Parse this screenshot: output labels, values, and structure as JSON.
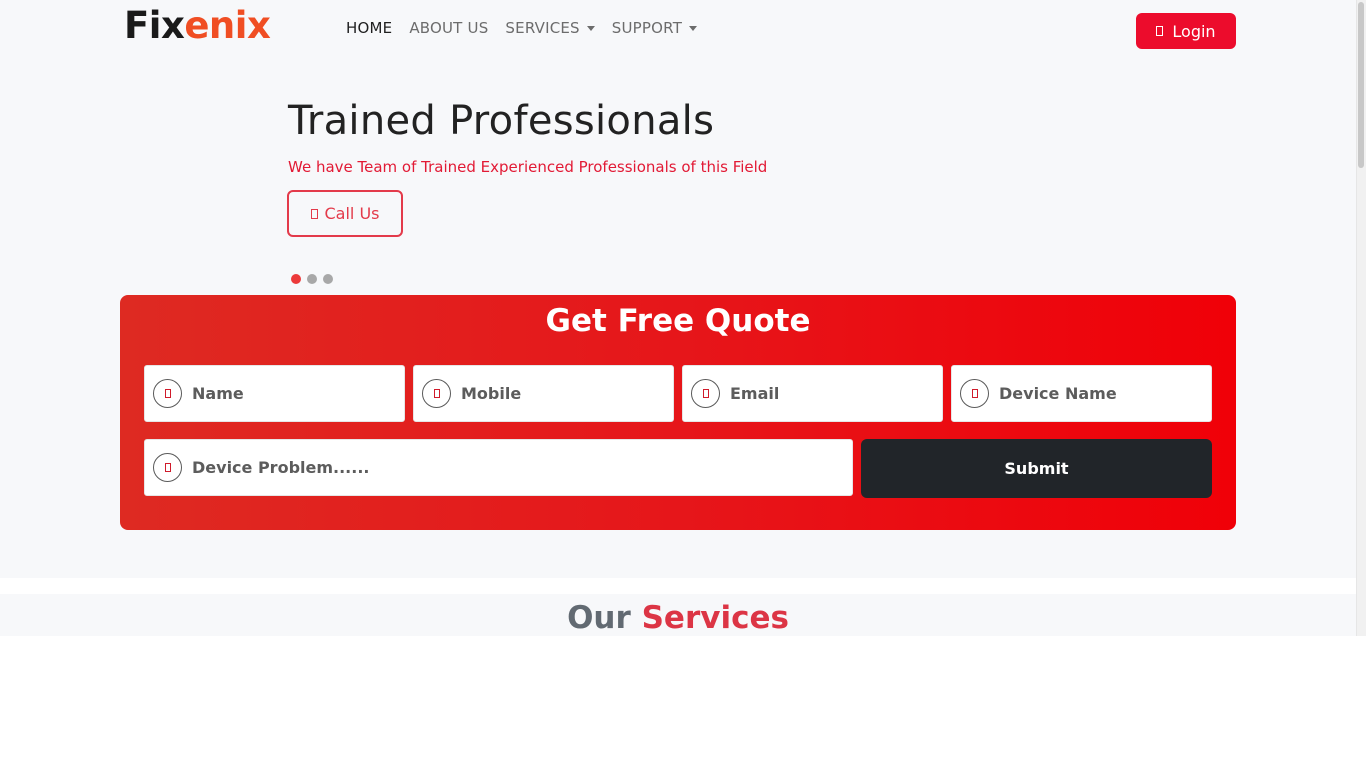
{
  "brand": {
    "part1": "Fix",
    "part2": "enix"
  },
  "nav": {
    "home": "HOME",
    "about": "ABOUT US",
    "services": "SERVICES",
    "support": "SUPPORT"
  },
  "login": {
    "label": "Login",
    "icon": "user-icon"
  },
  "hero": {
    "title": "Trained Professionals",
    "subtitle": "We have Team of Trained Experienced Professionals of this Field",
    "call_label": "Call Us",
    "call_icon": "phone-icon",
    "slides": 3,
    "active_slide": 1
  },
  "quote": {
    "title": "Get Free Quote",
    "name_placeholder": "Name",
    "mobile_placeholder": "Mobile",
    "email_placeholder": "Email",
    "device_placeholder": "Device Name",
    "problem_placeholder": "Device Problem......",
    "submit_label": "Submit"
  },
  "services_section": {
    "title_part1": "Our",
    "title_part2": "Services"
  },
  "colors": {
    "brand_red": "#ec0c2c",
    "logo_orange": "#f04e23",
    "dark": "#212529",
    "services_red": "#dc3545"
  }
}
